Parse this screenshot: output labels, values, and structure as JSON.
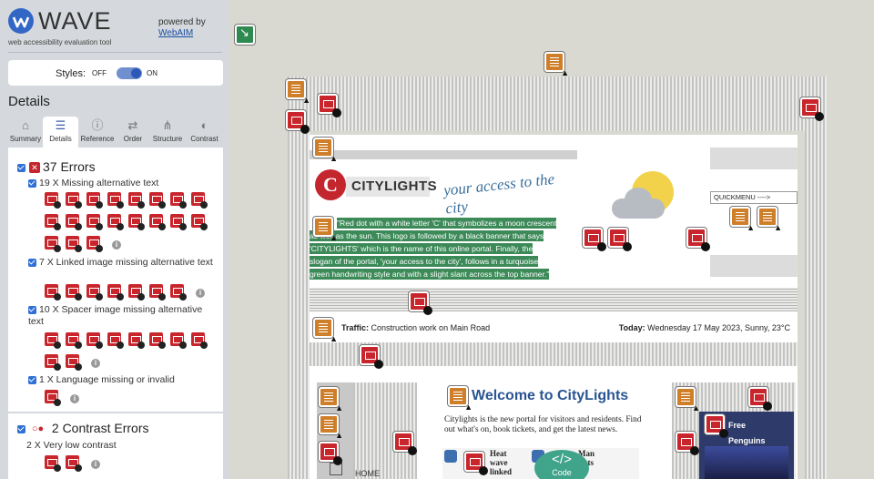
{
  "header": {
    "logo_text": "WAVE",
    "tagline": "web accessibility evaluation tool",
    "powered_by": "powered by",
    "powered_link": "WebAIM"
  },
  "styles": {
    "label": "Styles:",
    "off": "OFF",
    "on": "ON",
    "state": "on"
  },
  "details_title": "Details",
  "tabs": [
    {
      "label": "Summary",
      "icon": "home-icon"
    },
    {
      "label": "Details",
      "icon": "list-icon",
      "active": true
    },
    {
      "label": "Reference",
      "icon": "info-icon"
    },
    {
      "label": "Order",
      "icon": "order-icon"
    },
    {
      "label": "Structure",
      "icon": "structure-icon"
    },
    {
      "label": "Contrast",
      "icon": "contrast-icon"
    }
  ],
  "errors": {
    "title": "37 Errors",
    "groups": [
      {
        "label": "19 X Missing alternative text",
        "count": 19
      },
      {
        "label": "7 X Linked image missing alternative text",
        "count": 7
      },
      {
        "label": "10 X Spacer image missing alternative text",
        "count": 10
      },
      {
        "label": "1 X Language missing or invalid",
        "count": 1
      }
    ]
  },
  "contrast": {
    "title": "2 Contrast Errors",
    "groups": [
      {
        "label": "2 X Very low contrast",
        "count": 2
      }
    ]
  },
  "preview": {
    "brand": "CITYLIGHTS",
    "tagline": "your access to the city",
    "alt_text_lines": [
      "\"Red dot with a white letter 'C' that symbolizes a moon crescent",
      "as well as the sun. This logo is followed by a black banner that says",
      "'CITYLIGHTS' which is the name of this online portal. Finally, the",
      "slogan of the portal, 'your access to the city', follows in a turquoise",
      "green handwriting style and with a slight slant across the top banner.\""
    ],
    "quickmenu": "QUICKMENU ---->",
    "traffic_label": "Traffic:",
    "traffic_text": "Construction work on Main Road",
    "today_label": "Today:",
    "today_text": "Wednesday 17 May 2023, Sunny, 23°C",
    "home_label": "HOME",
    "welcome_title": "Welcome to CityLights",
    "welcome_text": "Citylights is the new portal for visitors and residents. Find out what's on, book tickets, and get the latest news.",
    "news1": "Heat wave linked",
    "news2": "Man tests ne",
    "free_label": "Free Penguins",
    "code_button": "Code"
  },
  "colors": {
    "error": "#c8262c",
    "alert": "#cf7f2a",
    "accent": "#3367c6",
    "alt_highlight": "#3c8a58"
  }
}
